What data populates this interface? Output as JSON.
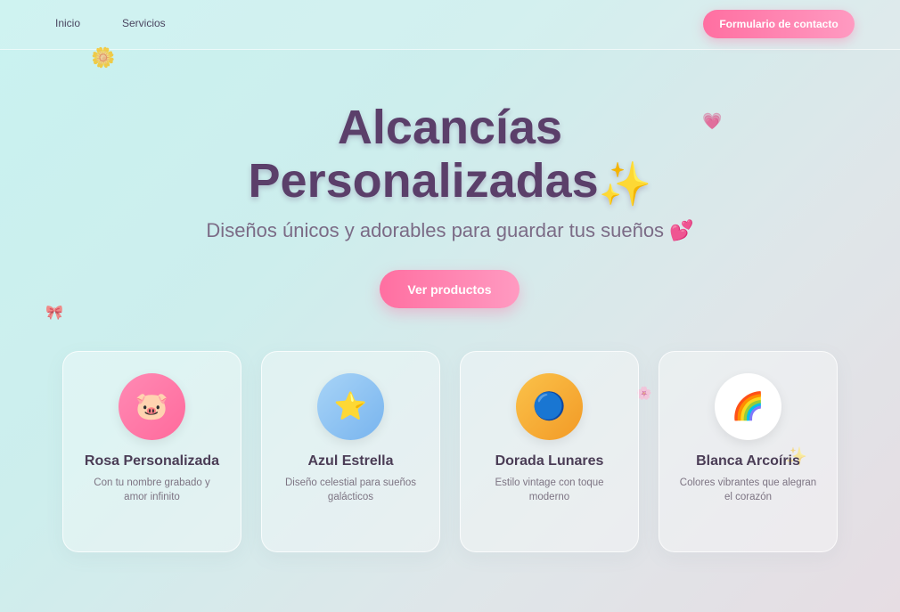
{
  "nav": {
    "links": [
      "Inicio",
      "Servicios"
    ],
    "contact_label": "Formulario de contacto"
  },
  "hero": {
    "title_line1": "Alcancías",
    "title_line2": "Personalizadas",
    "title_emoji": "✨",
    "subtitle": "Diseños únicos y adorables para guardar tus sueños 💕",
    "cta_label": "Ver productos"
  },
  "cards": [
    {
      "icon": "🐷",
      "name": "Rosa Personalizada",
      "desc": "Con tu nombre grabado y amor infinito",
      "color": "#ff7aa8"
    },
    {
      "icon": "⭐",
      "name": "Azul Estrella",
      "desc": "Diseño celestial para sueños galácticos",
      "color": "#8cc2f2"
    },
    {
      "icon": "🔵",
      "name": "Dorada Lunares",
      "desc": "Estilo vintage con toque moderno",
      "color": "#f6ad33"
    },
    {
      "icon": "🌈",
      "name": "Blanca Arcoíris",
      "desc": "Colores vibrantes que alegran el corazón",
      "color": "#ffffff"
    }
  ],
  "decorations": [
    "🌼",
    "💗",
    "🎀",
    "🌸",
    "✨"
  ]
}
